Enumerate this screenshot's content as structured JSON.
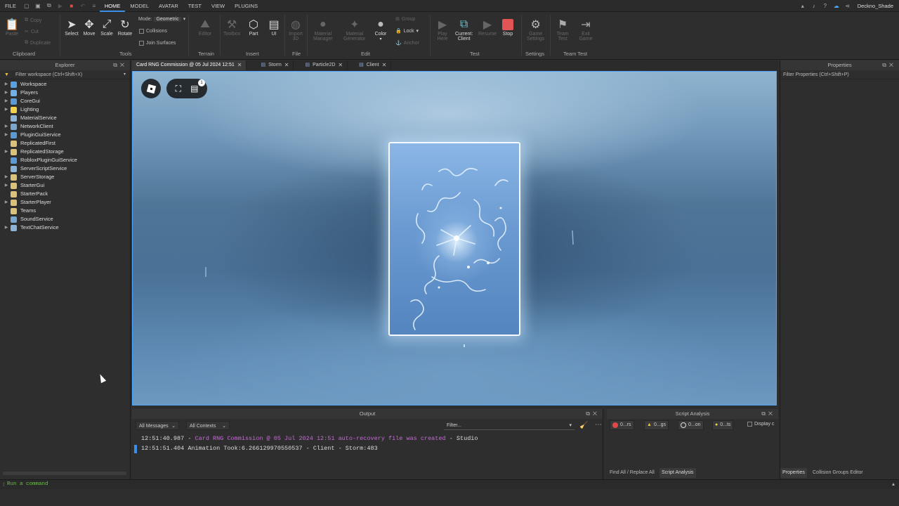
{
  "menu": {
    "items": [
      "FILE",
      "HOME",
      "MODEL",
      "AVATAR",
      "TEST",
      "VIEW",
      "PLUGINS"
    ],
    "active": "HOME",
    "user": "Deckno_Shade"
  },
  "ribbon": {
    "clipboard": {
      "paste": "Paste",
      "copy": "Copy",
      "cut": "Cut",
      "duplicate": "Duplicate",
      "label": "Clipboard"
    },
    "tools": {
      "select": "Select",
      "move": "Move",
      "scale": "Scale",
      "rotate": "Rotate",
      "mode_label": "Mode:",
      "mode_value": "Geometric",
      "collisions": "Collisions",
      "join_surfaces": "Join Surfaces",
      "label": "Tools"
    },
    "terrain": {
      "editor": "Editor",
      "label": "Terrain"
    },
    "insert": {
      "toolbox": "Toolbox",
      "part": "Part",
      "ui": "UI",
      "label": "Insert"
    },
    "file": {
      "import3d_1": "Import",
      "import3d_2": "3D",
      "label": "File"
    },
    "edit": {
      "material_1": "Material",
      "material_2": "Manager",
      "mat_gen_1": "Material",
      "mat_gen_2": "Generator",
      "color": "Color",
      "group": "Group",
      "lock": "Lock",
      "anchor": "Anchor",
      "label": "Edit"
    },
    "test": {
      "play_1": "Play",
      "play_2": "Here",
      "current_1": "Current:",
      "current_2": "Client",
      "resume": "Resume",
      "stop": "Stop",
      "label": "Test"
    },
    "settings": {
      "game_1": "Game",
      "game_2": "Settings",
      "label": "Settings"
    },
    "team": {
      "team_1": "Team",
      "team_2": "Test",
      "exit_1": "Exit",
      "exit_2": "Game",
      "label": "Team Test"
    }
  },
  "explorer": {
    "title": "Explorer",
    "filter": "Filter workspace (Ctrl+Shift+X)",
    "items": [
      {
        "label": "Workspace",
        "color": "#5aa0e0",
        "arrow": true
      },
      {
        "label": "Players",
        "color": "#6fb0e8",
        "arrow": true
      },
      {
        "label": "CoreGui",
        "color": "#5b9bd5",
        "arrow": true
      },
      {
        "label": "Lighting",
        "color": "#f2d24b",
        "arrow": true
      },
      {
        "label": "MaterialService",
        "color": "#8cb4d8",
        "arrow": false
      },
      {
        "label": "NetworkClient",
        "color": "#7aa6d0",
        "arrow": true
      },
      {
        "label": "PluginGuiService",
        "color": "#5b9bd5",
        "arrow": true
      },
      {
        "label": "ReplicatedFirst",
        "color": "#d9c27a",
        "arrow": false
      },
      {
        "label": "ReplicatedStorage",
        "color": "#d9c27a",
        "arrow": true
      },
      {
        "label": "RobloxPluginGuiService",
        "color": "#5b9bd5",
        "arrow": false
      },
      {
        "label": "ServerScriptService",
        "color": "#8cb4d8",
        "arrow": false
      },
      {
        "label": "ServerStorage",
        "color": "#d9c27a",
        "arrow": true
      },
      {
        "label": "StarterGui",
        "color": "#d9c27a",
        "arrow": true
      },
      {
        "label": "StarterPack",
        "color": "#d9c27a",
        "arrow": false
      },
      {
        "label": "StarterPlayer",
        "color": "#d9c27a",
        "arrow": true
      },
      {
        "label": "Teams",
        "color": "#d9c27a",
        "arrow": false
      },
      {
        "label": "SoundService",
        "color": "#7aa6d0",
        "arrow": false
      },
      {
        "label": "TextChatService",
        "color": "#8cb4d8",
        "arrow": true
      }
    ]
  },
  "tabs": [
    {
      "label": "Card RNG Commission @ 05 Jul 2024 12:51",
      "active": true
    },
    {
      "label": "Storm",
      "active": false
    },
    {
      "label": "Particle2D",
      "active": false
    },
    {
      "label": "Client",
      "active": false
    }
  ],
  "viewport": {
    "badge_count": "1"
  },
  "output": {
    "title": "Output",
    "messages_filter": "All Messages",
    "contexts_filter": "All Contexts",
    "filter_placeholder": "Filter...",
    "lines": [
      {
        "time": "12:51:40.987",
        "text": "Card RNG Commission @ 05 Jul 2024 12:51 auto-recovery file was created",
        "source": "Studio",
        "color": "#c56bd6"
      },
      {
        "time": "12:51:51.404",
        "text": "Animation Took:6.266129970550537",
        "source": "Client - Storm:483",
        "color": "#dddddd"
      }
    ]
  },
  "script_analysis": {
    "title": "Script Analysis",
    "errors": "0...rs",
    "warnings": "0...gs",
    "info": "0...on",
    "hints": "0...ts",
    "display": "Display c",
    "tab_find": "Find All / Replace All",
    "tab_sa": "Script Analysis"
  },
  "properties": {
    "title": "Properties",
    "filter": "Filter Properties (Ctrl+Shift+P)",
    "tab_props": "Properties",
    "tab_collision": "Collision Groups Editor"
  },
  "command": {
    "placeholder": "Run a command"
  }
}
